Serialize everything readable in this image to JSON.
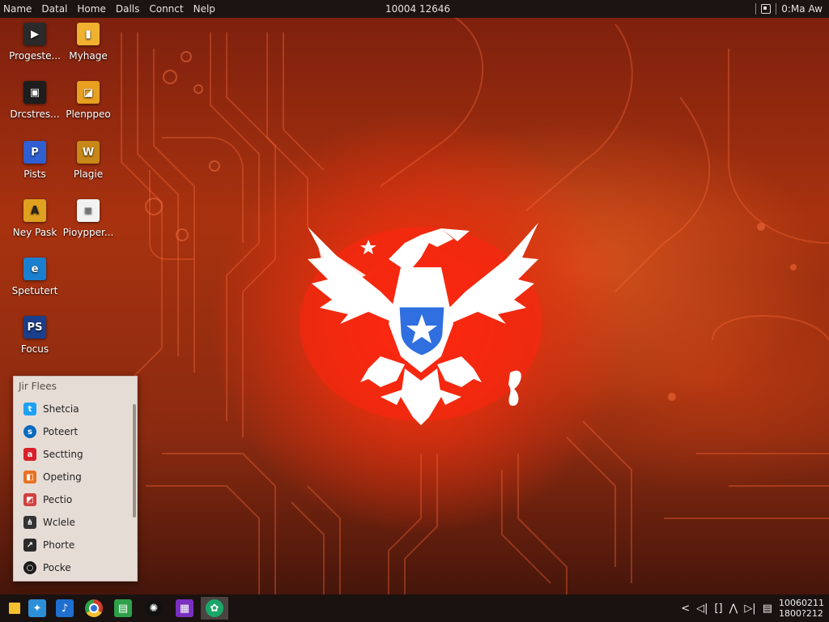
{
  "menubar": {
    "items": [
      "Name",
      "Datal",
      "Home",
      "Dalls",
      "Connct",
      "Nelp"
    ],
    "clock": "10004 12646",
    "right_text": "0:Ma Aw"
  },
  "desktop_icons": [
    {
      "label": "Progeste...",
      "icon": "video-file-icon",
      "color": "#2a2a2a"
    },
    {
      "label": "Myhage",
      "icon": "folder-icon",
      "color": "#f0b030"
    },
    {
      "label": "Drcstres...",
      "icon": "film-icon",
      "color": "#1d1d1d"
    },
    {
      "label": "Plenppeo",
      "icon": "image-icon",
      "color": "#e8a020"
    },
    {
      "label": "Pists",
      "icon": "gamepad-icon",
      "color": "#2f5fd0"
    },
    {
      "label": "Plagie",
      "icon": "image-file-icon",
      "color": "#c88818"
    },
    {
      "label": "Ney Pask",
      "icon": "document-icon",
      "color": "#e0a020"
    },
    {
      "label": "Pioypper...",
      "icon": "blank-file-icon",
      "color": "#f2f2f2"
    },
    {
      "label": "Spetutert",
      "icon": "app-icon",
      "color": "#1b7fd0"
    },
    {
      "label": "Focus",
      "icon": "photoshop-icon",
      "color": "#1b3f8a"
    }
  ],
  "files_panel": {
    "title": "Jir Flees",
    "items": [
      {
        "label": "Shetcia",
        "icon": "twitter-icon",
        "color": "#1da1f2",
        "glyph": "t"
      },
      {
        "label": "Poteert",
        "icon": "chat-icon",
        "color": "#0a6abf",
        "glyph": "s"
      },
      {
        "label": "Sectting",
        "icon": "settings-icon",
        "color": "#d8202a",
        "glyph": "a"
      },
      {
        "label": "Opeting",
        "icon": "colors-icon",
        "color": "#e87020",
        "glyph": "◧"
      },
      {
        "label": "Pectio",
        "icon": "palette-icon",
        "color": "#d04040",
        "glyph": "◩"
      },
      {
        "label": "Wclele",
        "icon": "share-icon",
        "color": "#333333",
        "glyph": "⋔"
      },
      {
        "label": "Phorte",
        "icon": "phone-icon",
        "color": "#2a2a2a",
        "glyph": "↗"
      },
      {
        "label": "Pocke",
        "icon": "ring-icon",
        "color": "#1a1a1a",
        "glyph": "○"
      }
    ]
  },
  "taskbar": {
    "apps": [
      {
        "name": "file-explorer-icon",
        "color": "#f5c030",
        "glyph": ""
      },
      {
        "name": "photos-icon",
        "color": "#2d8fd8",
        "glyph": "✦"
      },
      {
        "name": "store-icon",
        "color": "#1e6fd0",
        "glyph": "♪"
      },
      {
        "name": "chrome-icon",
        "color": "#d33a2a",
        "glyph": "●"
      },
      {
        "name": "spreadsheet-icon",
        "color": "#2ea04a",
        "glyph": "▤"
      },
      {
        "name": "terminal-icon",
        "color": "#111111",
        "glyph": "✺"
      },
      {
        "name": "grid-app-icon",
        "color": "#7a2fc0",
        "glyph": "▦"
      },
      {
        "name": "xbox-icon",
        "color": "#1aa86a",
        "glyph": "✿"
      }
    ],
    "tray_icons": [
      "share-icon",
      "volume-icon",
      "window-icon",
      "wifi-icon",
      "network-icon",
      "battery-icon"
    ],
    "tray_glyphs": [
      "<",
      "◁|",
      "[]",
      "⋀",
      "▷|",
      "▤"
    ],
    "clock_line1": "10060211",
    "clock_line2": "1800?212"
  }
}
